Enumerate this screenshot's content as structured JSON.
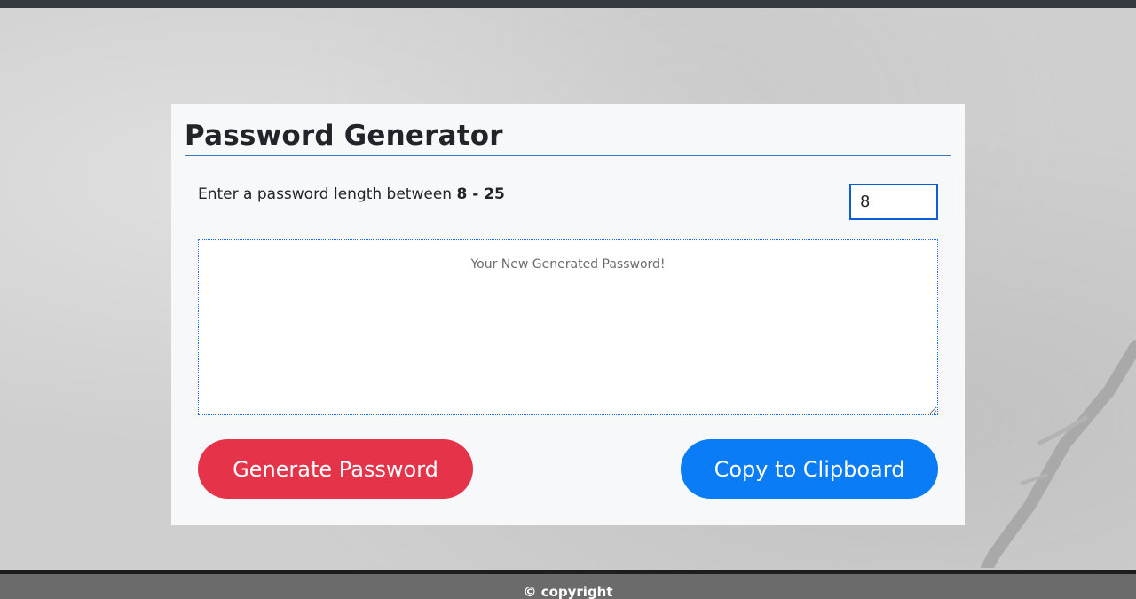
{
  "header": {
    "bar_color": "#343a40"
  },
  "card": {
    "title": "Password Generator",
    "length_prompt": "Enter a password length between",
    "length_range": "8 - 25",
    "length_value": "8",
    "password_placeholder": "Your New Generated Password!",
    "password_value": ""
  },
  "buttons": {
    "generate_label": "Generate Password",
    "copy_label": "Copy to Clipboard"
  },
  "footer": {
    "text": "© copyright"
  },
  "colors": {
    "generate_button": "#e5334a",
    "copy_button": "#0a7cf5",
    "card_background": "#f7f8fa",
    "title_rule": "#3a7bc8",
    "footer_background": "#6b6b6b"
  }
}
